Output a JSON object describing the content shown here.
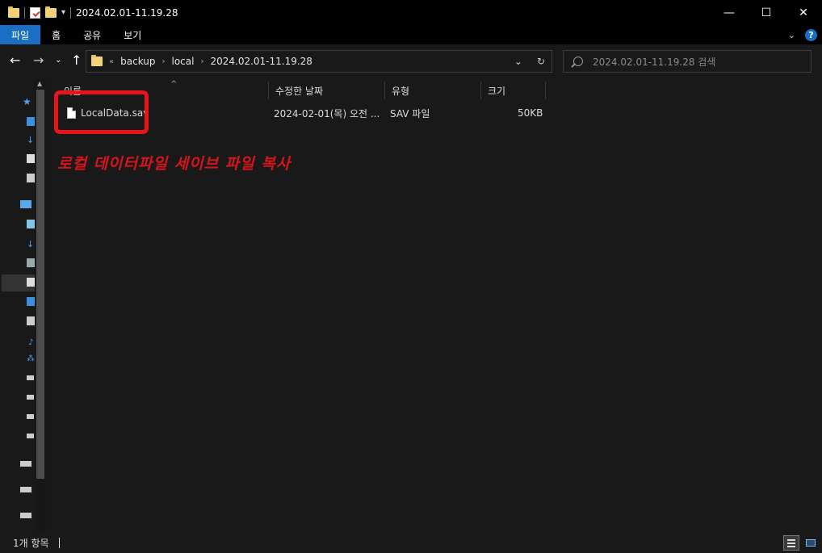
{
  "window": {
    "title": "2024.02.01-11.19.28",
    "minimize": "—",
    "maximize": "☐",
    "close": "✕"
  },
  "ribbon": {
    "tabs": [
      {
        "label": "파일"
      },
      {
        "label": "홈"
      },
      {
        "label": "공유"
      },
      {
        "label": "보기"
      }
    ],
    "help": "?"
  },
  "address": {
    "overflow": "«",
    "crumbs": [
      "backup",
      "local",
      "2024.02.01-11.19.28"
    ]
  },
  "search": {
    "placeholder": "2024.02.01-11.19.28 검색"
  },
  "columns": {
    "name": "이름",
    "modified": "수정한 날짜",
    "type": "유형",
    "size": "크기"
  },
  "files": [
    {
      "name": "LocalData.sav",
      "modified": "2024-02-01(목) 오전 ...",
      "type": "SAV 파일",
      "size": "50KB"
    }
  ],
  "annotation": "로컬 데이터파일 세이브 파일 복사",
  "status": {
    "item_count": "1개 항목"
  },
  "colors": {
    "accent": "#1a6fc4",
    "annotation_red": "#e8141b",
    "background": "#191919"
  }
}
